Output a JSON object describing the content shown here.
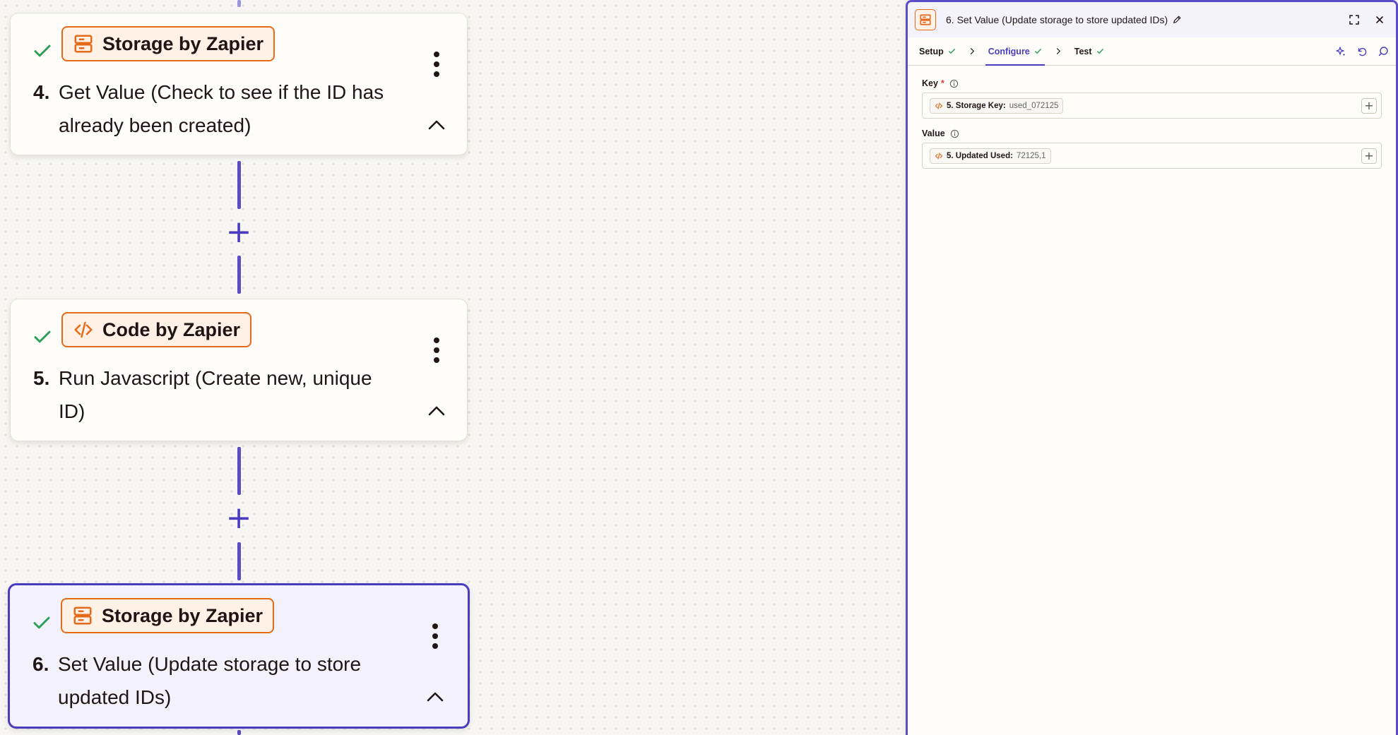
{
  "canvas": {
    "steps": [
      {
        "app": "Storage by Zapier",
        "number": "4.",
        "title_line1": "Get Value (Check to see if the ID has",
        "title_line2": "already been created)"
      },
      {
        "app": "Code by Zapier",
        "number": "5.",
        "title_line1": "Run Javascript (Create new, unique",
        "title_line2": "ID)"
      },
      {
        "app": "Storage by Zapier",
        "number": "6.",
        "title_line1": "Set Value (Update storage to store",
        "title_line2": "updated IDs)"
      }
    ],
    "add_step_symbol": "+"
  },
  "panel": {
    "title": "6. Set Value (Update storage to store updated IDs)",
    "tabs": [
      {
        "label": "Setup",
        "status": "complete"
      },
      {
        "label": "Configure",
        "status": "complete"
      },
      {
        "label": "Test",
        "status": "complete"
      }
    ],
    "active_tab": "Configure",
    "fields": [
      {
        "label": "Key",
        "required_mark": "*",
        "pill_label": "5. Storage Key:",
        "pill_value": "used_072125"
      },
      {
        "label": "Value",
        "required_mark": "",
        "pill_label": "5. Updated Used:",
        "pill_value": "72125,1"
      }
    ],
    "add_symbol": "+"
  },
  "colors": {
    "accent": "#4a3bbf",
    "brand_orange": "#e56a1a",
    "success": "#2e9e5b",
    "required": "#e0393e"
  },
  "icons": {
    "storage": "storage-icon",
    "code": "code-icon",
    "check": "check-icon",
    "more": "more-vertical-icon",
    "collapse": "chevron-up-icon",
    "edit": "pencil-icon",
    "expand": "expand-icon",
    "close": "close-icon",
    "ai": "sparkle-icon",
    "undo": "undo-icon",
    "comment": "comment-icon",
    "info": "info-icon"
  }
}
